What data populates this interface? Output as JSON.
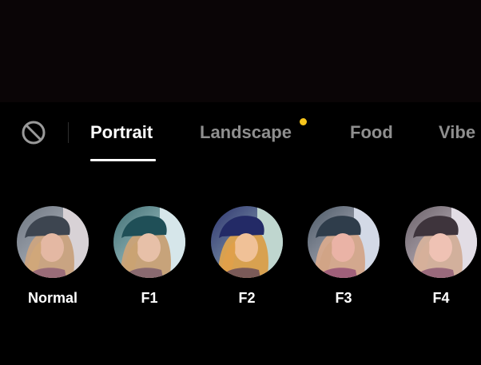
{
  "tabs": [
    {
      "label": "Portrait",
      "active": true
    },
    {
      "label": "Landscape",
      "active": false,
      "has_new_badge": true
    },
    {
      "label": "Food",
      "active": false
    },
    {
      "label": "Vibe",
      "active": false
    }
  ],
  "no_filter_icon": "no-filter-icon",
  "filters": [
    {
      "label": "Normal",
      "selected": false
    },
    {
      "label": "F1",
      "selected": false
    },
    {
      "label": "F2",
      "selected": false
    },
    {
      "label": "F3",
      "selected": false
    },
    {
      "label": "F4",
      "selected": false
    }
  ],
  "colors": {
    "background": "#000000",
    "active_tab": "#ffffff",
    "inactive_tab": "#8f8f8f",
    "new_badge": "#f7c51c"
  }
}
